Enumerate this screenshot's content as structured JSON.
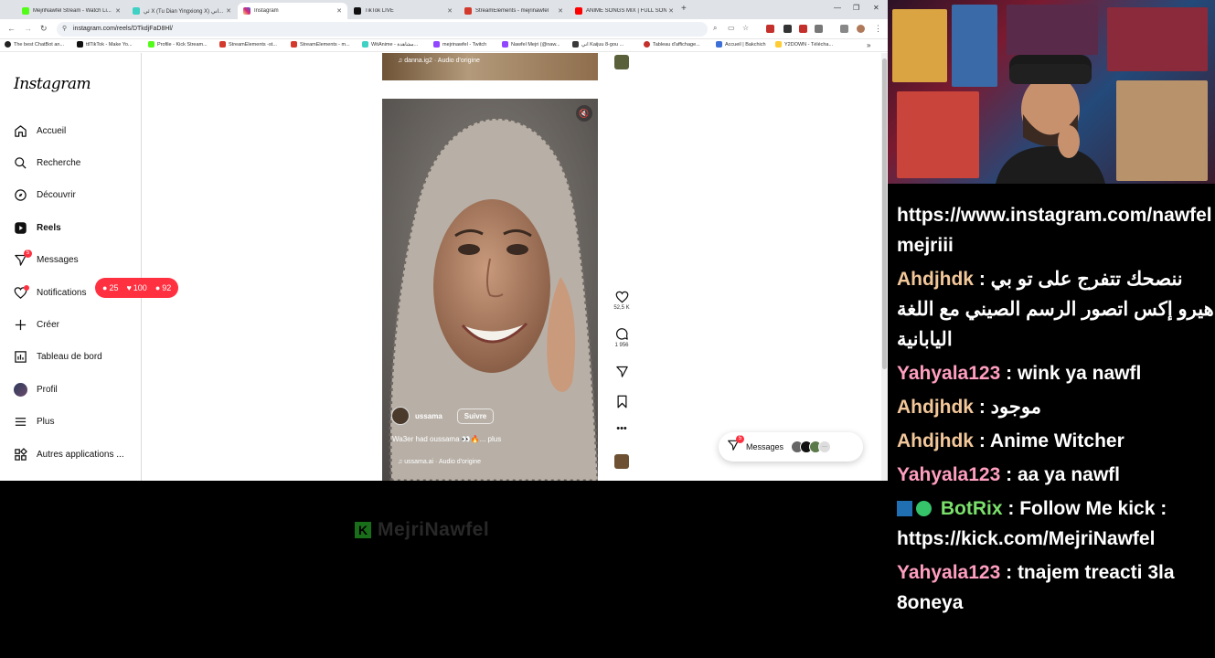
{
  "browser": {
    "tabs": [
      {
        "title": "MejriNawfel Stream - Watch Li...",
        "color": "#53fc18"
      },
      {
        "title": "ئي X (Tu Dian Yingxiong X) اني...",
        "color": "#3fd1c4"
      },
      {
        "title": "Instagram",
        "color": "#d62976"
      },
      {
        "title": "TikTok LIVE",
        "color": "#111111"
      },
      {
        "title": "StreamElements - mejrinawfel",
        "color": "#d33a2c"
      },
      {
        "title": "ANIME SONGS MIX | FULL SONG...",
        "color": "#ff0000"
      }
    ],
    "new_tab": "+",
    "url": "instagram.com/reels/DTkdjFaD8Hl/",
    "bookmarks": [
      "The best ChatBot an...",
      "ttlTikTok - Make Yo...",
      "Profile - Kick Stream...",
      "StreamElements -st...",
      "StreamElements - m...",
      "WitAnime - مشاهدة...",
      "mejrinawfel - Twitch",
      "Nawfel Mejri (@naw...",
      "اني Kaijuu 8-gou ...",
      "Tableau d'affichage...",
      "Accueil | Bakchich",
      "Y2DOWN - Télécha..."
    ]
  },
  "instagram": {
    "logo": "Instagram",
    "nav": [
      {
        "label": "Accueil",
        "icon": "home-icon"
      },
      {
        "label": "Recherche",
        "icon": "search-icon"
      },
      {
        "label": "Découvrir",
        "icon": "compass-icon"
      },
      {
        "label": "Reels",
        "icon": "reels-icon"
      },
      {
        "label": "Messages",
        "icon": "messenger-icon",
        "badge": "5"
      },
      {
        "label": "Notifications",
        "icon": "heart-icon"
      },
      {
        "label": "Créer",
        "icon": "plus-icon"
      },
      {
        "label": "Tableau de bord",
        "icon": "dashboard-icon"
      },
      {
        "label": "Profil",
        "icon": "profile-avatar-icon"
      },
      {
        "label": "Plus",
        "icon": "menu-icon"
      },
      {
        "label": "Autres applications ...",
        "icon": "apps-icon"
      }
    ],
    "notif_pill": {
      "comments": "25",
      "likes": "100",
      "followers": "92"
    },
    "prev_reel_audio": "danna.ig2 · Audio d'origine",
    "reel": {
      "username": "ussama",
      "follow": "Suivre",
      "caption": "Wa3er had oussama 👀🔥... plus",
      "audio": "ussama.ai · Audio d'origine",
      "likes": "52,5 K",
      "comments": "1 956"
    },
    "messages_pill": {
      "label": "Messages",
      "badge": "5"
    }
  },
  "stream": {
    "watermark": "MejriNawfel",
    "chat": [
      {
        "user": "",
        "color": "#ffffff",
        "text": "https://www.instagram.com/nawfel mejriii"
      },
      {
        "user": "Ahdjhdk",
        "color": "#f2c79a",
        "text": "ننصحك تتفرج على تو بي هيرو إكس اتصور الرسم الصيني مع اللغة اليابانية"
      },
      {
        "user": "Yahyala123",
        "color": "#ff9ebf",
        "text": "wink ya nawfl"
      },
      {
        "user": "Ahdjhdk",
        "color": "#f2c79a",
        "text": "موجود"
      },
      {
        "user": "Ahdjhdk",
        "color": "#f2c79a",
        "text": "Anime Witcher"
      },
      {
        "user": "Yahyala123",
        "color": "#ff9ebf",
        "text": "aa ya nawfl"
      },
      {
        "user": "BotRix",
        "color": "#7be06b",
        "text": "Follow Me kick : https://kick.com/MejriNawfel",
        "badges": true
      },
      {
        "user": "Yahyala123",
        "color": "#ff9ebf",
        "text": "tnajem treacti 3la 8oneya"
      }
    ]
  }
}
